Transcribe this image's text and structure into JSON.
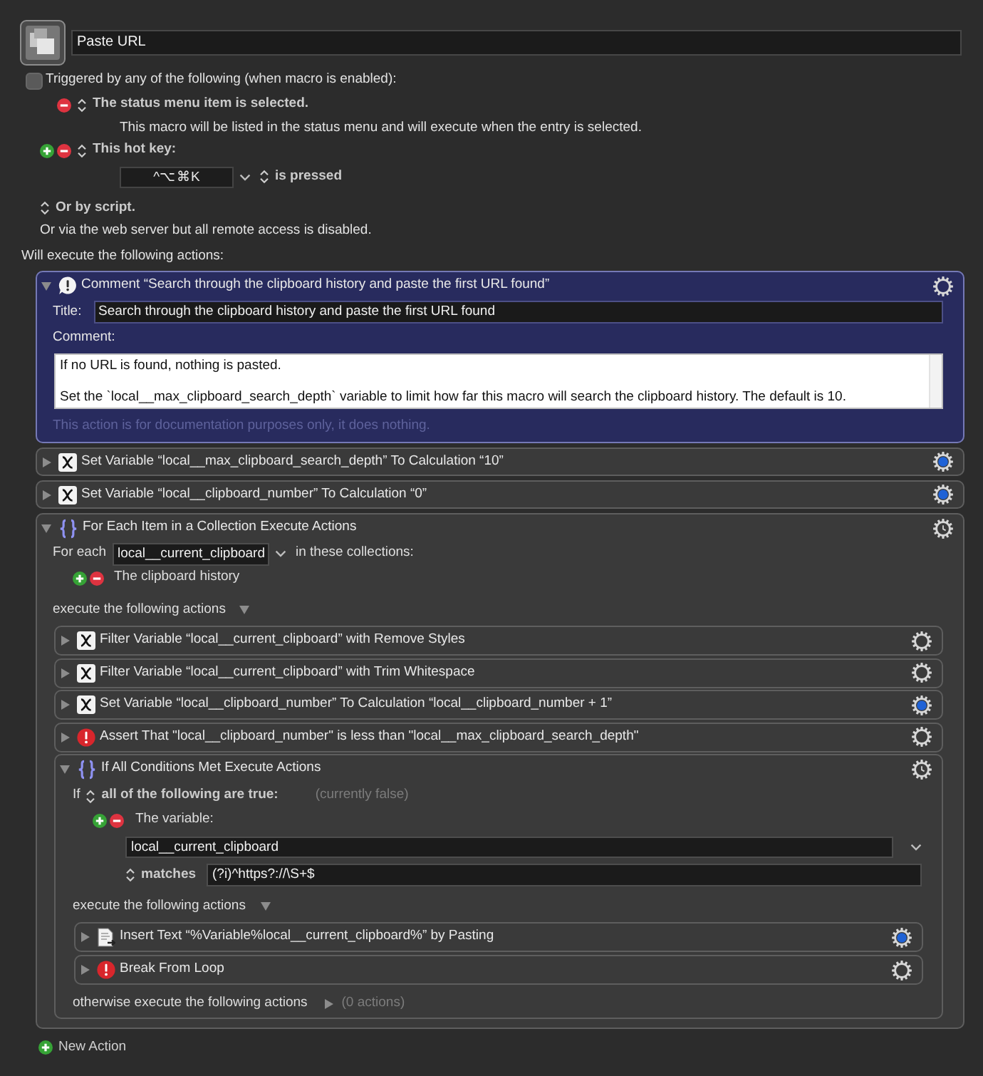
{
  "macro": {
    "name": "Paste URL"
  },
  "triggers": {
    "label": "Triggered by any of the following (when macro is enabled):",
    "checked": false,
    "items": [
      {
        "kind": "status_menu",
        "can_add": false,
        "title": "The status menu item is selected.",
        "description": "This macro will be listed in the status menu and will execute when the entry is selected."
      },
      {
        "kind": "hotkey",
        "can_add": true,
        "title": "This hot key:",
        "hotkey": "^⌥⌘K",
        "condition": "is pressed"
      }
    ],
    "script": "Or by script.",
    "web_server": "Or via the web server but all remote access is disabled."
  },
  "actions_heading": "Will execute the following actions:",
  "actions": [
    {
      "kind": "comment",
      "title": "Comment “Search through the clipboard history and paste the first URL found”",
      "expanded": true,
      "selected": true,
      "gear_filled": false,
      "gear_clock": false,
      "title_label": "Title:",
      "title_value": "Search through the clipboard history and paste the first URL found",
      "comment_label": "Comment:",
      "comment": [
        "If no URL is found, nothing is pasted.",
        "Set the `local__max_clipboard_search_depth` variable to limit how far this macro will search the clipboard history. The default is 10."
      ],
      "note": "This action is for documentation purposes only, it does nothing."
    },
    {
      "kind": "set_variable",
      "title": "Set Variable “local__max_clipboard_search_depth” To Calculation “10”",
      "expanded": false,
      "selected": false,
      "gear_filled": true,
      "gear_clock": false
    },
    {
      "kind": "set_variable",
      "title": "Set Variable “local__clipboard_number” To Calculation “0”",
      "expanded": false,
      "selected": false,
      "gear_filled": true,
      "gear_clock": false
    },
    {
      "kind": "for_each",
      "title": "For Each Item in a Collection Execute Actions",
      "expanded": true,
      "selected": false,
      "gear_filled": false,
      "gear_clock": true,
      "for_each_label": "For each",
      "variable": "local__current_clipboard",
      "collections_label": "in these collections:",
      "collections": [
        "The clipboard history"
      ],
      "execute": {
        "label": "execute the following actions",
        "expanded": true
      },
      "children": [
        {
          "kind": "filter_variable",
          "title": "Filter Variable “local__current_clipboard” with Remove Styles",
          "expanded": false,
          "selected": false,
          "gear_filled": false,
          "gear_clock": false
        },
        {
          "kind": "filter_variable",
          "title": "Filter Variable “local__current_clipboard” with Trim Whitespace",
          "expanded": false,
          "selected": false,
          "gear_filled": false,
          "gear_clock": false
        },
        {
          "kind": "set_variable",
          "title": "Set Variable “local__clipboard_number” To Calculation “local__clipboard_number + 1”",
          "expanded": false,
          "selected": false,
          "gear_filled": true,
          "gear_clock": false
        },
        {
          "kind": "assert",
          "title": "Assert That \"local__clipboard_number\" is less than \"local__max_clipboard_search_depth\"",
          "expanded": false,
          "selected": false,
          "gear_filled": false,
          "gear_clock": false
        },
        {
          "kind": "if",
          "title": "If All Conditions Met Execute Actions",
          "expanded": true,
          "selected": false,
          "gear_filled": false,
          "gear_clock": true,
          "if_label": "If",
          "match_mode": "all of the following are true:",
          "status": "(currently false)",
          "conditions": [
            {
              "label": "The variable:",
              "variable": "local__current_clipboard",
              "operator": "matches",
              "value": "(?i)^https?://\\S+$"
            }
          ],
          "execute": {
            "label": "execute the following actions",
            "expanded": true
          },
          "children": [
            {
              "kind": "insert_text",
              "title": "Insert Text “%Variable%local__current_clipboard%” by Pasting",
              "expanded": false,
              "selected": false,
              "gear_filled": true,
              "gear_clock": false
            },
            {
              "kind": "break",
              "title": "Break From Loop",
              "expanded": false,
              "selected": false,
              "gear_filled": false,
              "gear_clock": false
            }
          ],
          "otherwise": {
            "label": "otherwise execute the following actions",
            "expanded": false,
            "count": "(0 actions)"
          }
        }
      ]
    }
  ],
  "new_action": "New Action"
}
